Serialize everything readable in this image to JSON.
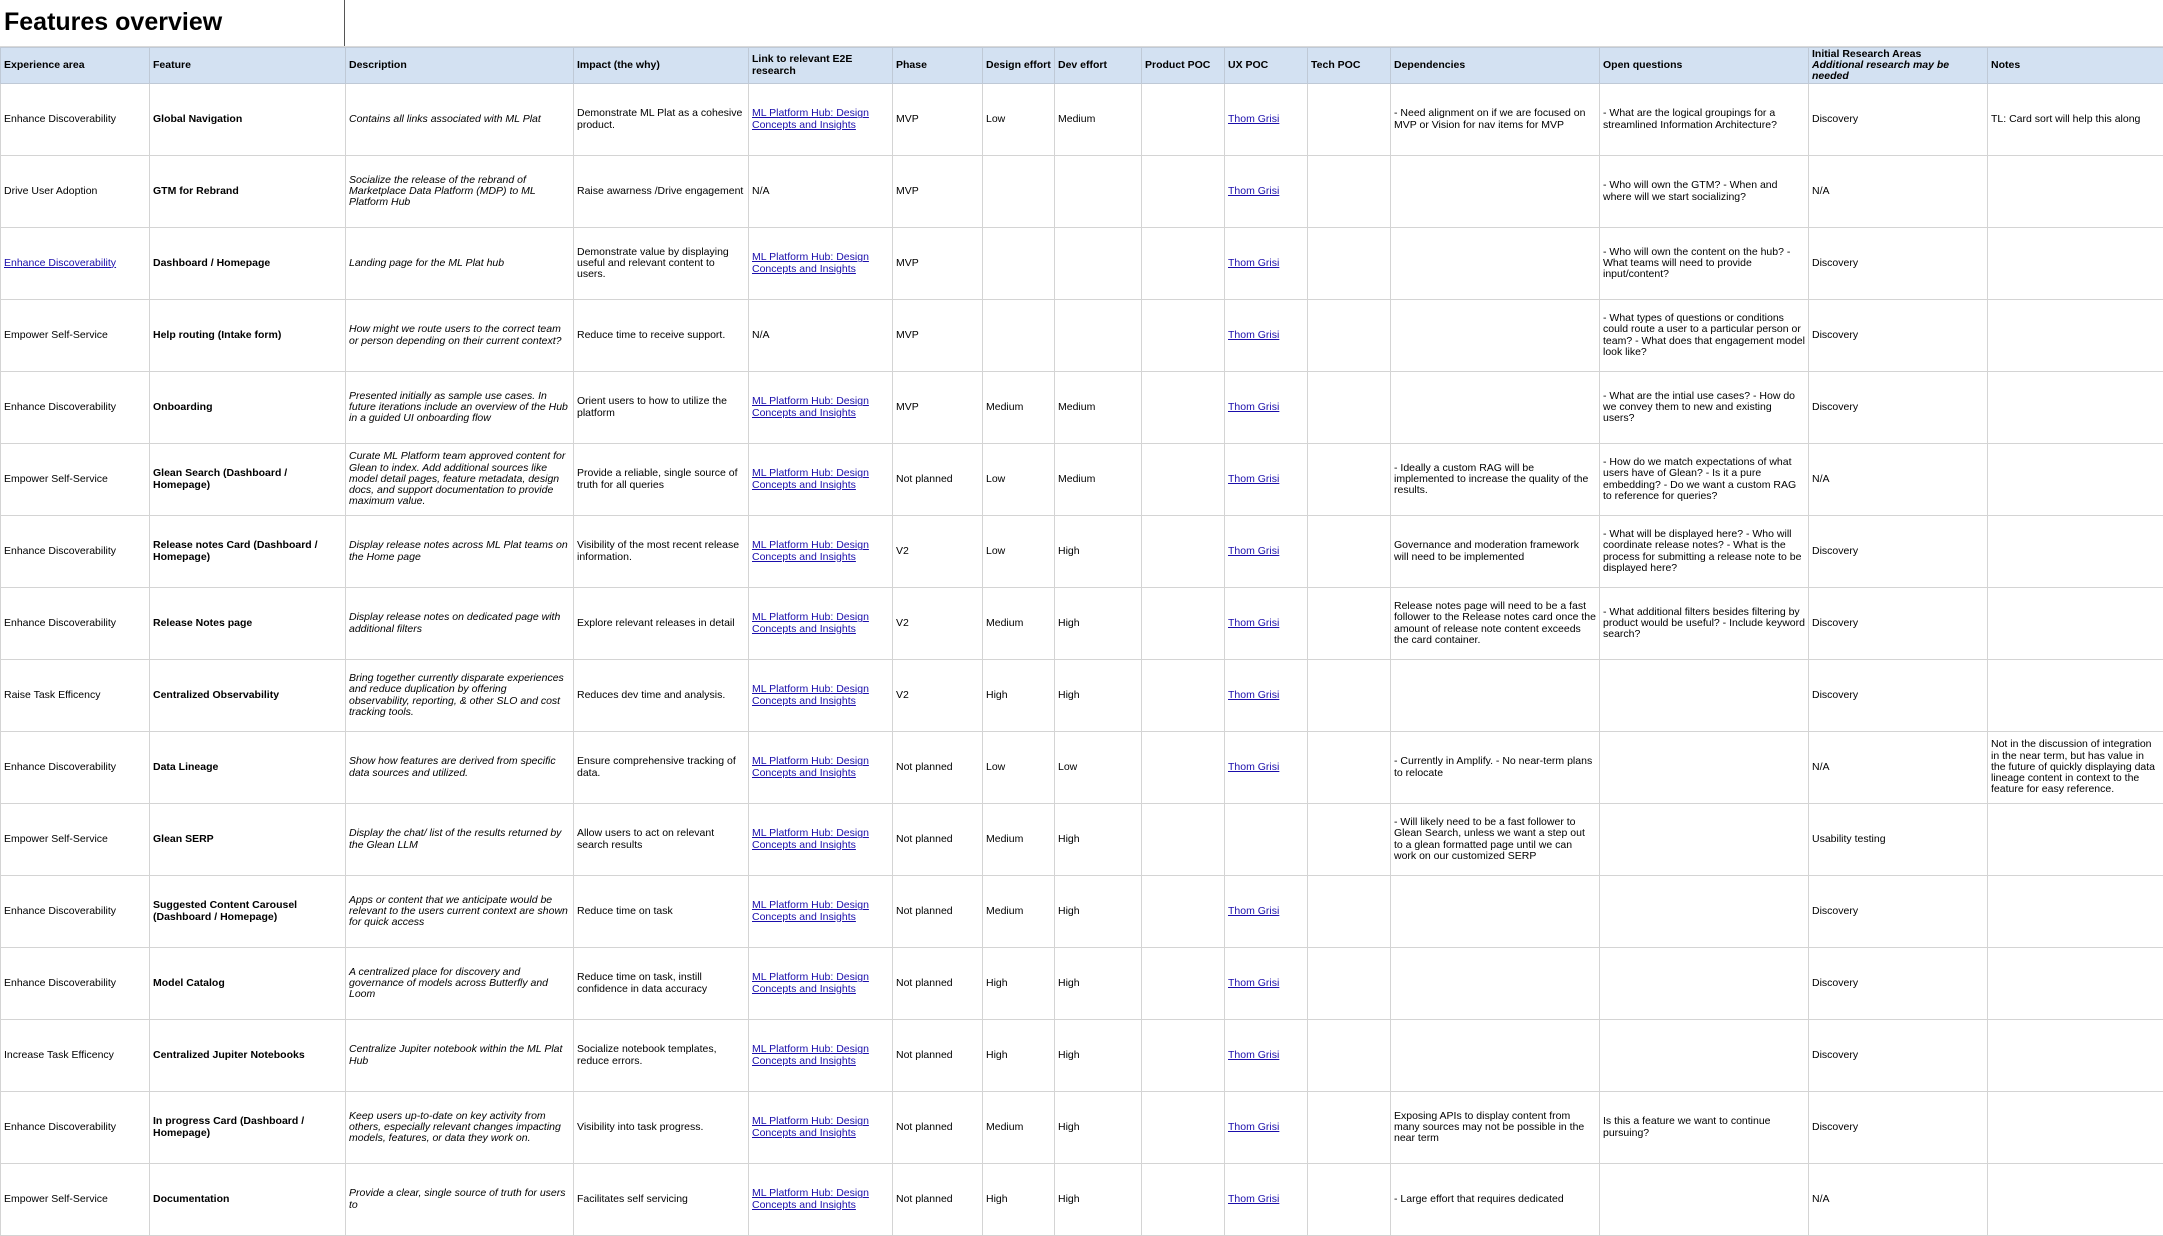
{
  "sheet": {
    "title": "Features overview"
  },
  "columns": [
    "Experience area",
    "Feature",
    "Description",
    "Impact (the why)",
    "Link to relevant E2E research",
    "Phase",
    "Design effort",
    "Dev effort",
    "Product POC",
    "UX POC",
    "Tech POC",
    "Dependencies",
    "Open questions",
    "Initial Research Areas",
    "Notes"
  ],
  "research_subheader": "Additional research may be needed",
  "rows": [
    {
      "area": "Enhance Discoverability",
      "area_link": false,
      "feature": "Global Navigation",
      "desc": "Contains all links associated with ML Plat",
      "impact": "Demonstrate ML Plat as a cohesive product.",
      "link": "ML Platform Hub: Design Concepts and Insights",
      "link_is_link": true,
      "phase": "MVP",
      "design": "Low",
      "dev": "Medium",
      "product": "",
      "ux": "Thom Grisi",
      "tech": "",
      "deps": "- Need alignment on if we are focused on MVP or Vision for nav items for MVP",
      "questions": "- What are the logical groupings for a streamlined Information Architecture?",
      "research": "Discovery",
      "notes": "TL: Card sort will help this along"
    },
    {
      "area": "Drive User Adoption",
      "area_link": false,
      "feature": "GTM for Rebrand",
      "desc": "Socialize the release of the rebrand of Marketplace Data Platform (MDP) to ML Platform Hub",
      "impact": "Raise awarness /Drive engagement",
      "link": "N/A",
      "link_is_link": false,
      "phase": "MVP",
      "design": "",
      "dev": "",
      "product": "",
      "ux": "Thom Grisi",
      "tech": "",
      "deps": "",
      "questions": "- Who will own the GTM?\n- When and where will we start socializing?",
      "research": "N/A",
      "notes": ""
    },
    {
      "area": "Enhance Discoverability",
      "area_link": true,
      "feature": "Dashboard / Homepage",
      "desc": "Landing page for the ML Plat hub",
      "impact": "Demonstrate value by displaying useful and relevant content to users.",
      "link": "ML Platform Hub: Design Concepts and Insights",
      "link_is_link": true,
      "phase": "MVP",
      "design": "",
      "dev": "",
      "product": "",
      "ux": "Thom Grisi",
      "tech": "",
      "deps": "",
      "questions": "- Who will own the content on the hub?\n- What teams will need to provide input/content?",
      "research": "Discovery",
      "notes": ""
    },
    {
      "area": "Empower Self-Service",
      "area_link": false,
      "feature": "Help routing (Intake form)",
      "desc": "How might we route users to the correct team or person depending on their current context?",
      "impact": "Reduce time to receive support.",
      "link": "N/A",
      "link_is_link": false,
      "phase": "MVP",
      "design": "",
      "dev": "",
      "product": "",
      "ux": "Thom Grisi",
      "tech": "",
      "deps": "",
      "questions": "- What types of questions or conditions could route a user to a particular person or team?\n- What does that engagement model look like?",
      "research": "Discovery",
      "notes": ""
    },
    {
      "area": "Enhance Discoverability",
      "area_link": false,
      "feature": "Onboarding",
      "desc": "Presented initially as sample use cases. In future iterations include an overview of the Hub in a guided UI onboarding flow",
      "impact": "Orient users to how to utilize the platform",
      "link": "ML Platform Hub: Design Concepts and Insights",
      "link_is_link": true,
      "phase": "MVP",
      "design": "Medium",
      "dev": "Medium",
      "product": "",
      "ux": "Thom Grisi",
      "tech": "",
      "deps": "",
      "questions": "- What are the intial use cases?\n- How do we convey them to new and existing users?",
      "research": "Discovery",
      "notes": ""
    },
    {
      "area": "Empower Self-Service",
      "area_link": false,
      "feature": "Glean Search (Dashboard / Homepage)",
      "desc": "Curate ML Platform team approved content for Glean to index. Add additional sources like model detail pages, feature metadata, design docs, and support documentation to provide maximum value.",
      "impact": "Provide a reliable, single source of truth for all queries",
      "link": "ML Platform Hub: Design Concepts and Insights",
      "link_is_link": true,
      "phase": "Not planned",
      "design": "Low",
      "dev": "Medium",
      "product": "",
      "ux": "Thom Grisi",
      "tech": "",
      "deps": "- Ideally a custom RAG will be implemented to increase the quality of the results.",
      "questions": "- How do we match expectations of what users have of Glean?\n- Is it a pure embedding?\n- Do we want a custom RAG to reference for queries?",
      "research": "N/A",
      "notes": ""
    },
    {
      "area": "Enhance Discoverability",
      "area_link": false,
      "feature": "Release notes Card (Dashboard / Homepage)",
      "desc": "Display release notes across ML Plat teams on the Home page",
      "impact": "Visibility of the most recent release information.",
      "link": "ML Platform Hub: Design Concepts and Insights",
      "link_is_link": true,
      "phase": "V2",
      "design": "Low",
      "dev": "High",
      "product": "",
      "ux": "Thom Grisi",
      "tech": "",
      "deps": "Governance and moderation framework will need to be implemented",
      "questions": "- What will be displayed here?\n- Who will coordinate release notes?\n- What is the process for submitting a release note to be displayed here?",
      "research": "Discovery",
      "notes": ""
    },
    {
      "area": "Enhance Discoverability",
      "area_link": false,
      "feature": "Release Notes page",
      "desc": "Display release notes on dedicated page with additional filters",
      "impact": "Explore relevant releases in detail",
      "link": "ML Platform Hub: Design Concepts and Insights",
      "link_is_link": true,
      "phase": "V2",
      "design": "Medium",
      "dev": "High",
      "product": "",
      "ux": "Thom Grisi",
      "tech": "",
      "deps": "Release notes page will need to be a fast follower to the Release notes card once the amount of release note content exceeds the card container.",
      "questions": "- What additional filters besides filtering by product would be useful?\n- Include keyword search?",
      "research": "Discovery",
      "notes": ""
    },
    {
      "area": "Raise Task Efficency",
      "area_link": false,
      "feature": "Centralized Observability",
      "desc": "Bring together currently disparate experiences and reduce duplication by offering observability, reporting, & other SLO and cost tracking tools.",
      "impact": "Reduces dev time and analysis.",
      "link": "ML Platform Hub: Design Concepts and Insights",
      "link_is_link": true,
      "phase": "V2",
      "design": "High",
      "dev": "High",
      "product": "",
      "ux": "Thom Grisi",
      "tech": "",
      "deps": "",
      "questions": "",
      "research": "Discovery",
      "notes": ""
    },
    {
      "area": "Enhance Discoverability",
      "area_link": false,
      "feature": "Data Lineage",
      "desc": "Show how features are derived from specific data sources and utilized.",
      "impact": "Ensure comprehensive tracking of data.",
      "link": "ML Platform Hub: Design Concepts and Insights",
      "link_is_link": true,
      "phase": "Not planned",
      "design": "Low",
      "dev": "Low",
      "product": "",
      "ux": "Thom Grisi",
      "tech": "",
      "deps": "- Currently in Amplify.\n- No near-term plans to relocate",
      "questions": "",
      "research": "N/A",
      "notes": "Not in the discussion of integration in the near term, but has value in the future of quickly displaying data lineage content in context to the feature for easy reference."
    },
    {
      "area": "Empower Self-Service",
      "area_link": false,
      "feature": "Glean SERP",
      "desc": "Display the chat/ list of the results returned by the Glean LLM",
      "impact": "Allow users to act on relevant search results",
      "link": "ML Platform Hub: Design Concepts and Insights",
      "link_is_link": true,
      "phase": "Not planned",
      "design": "Medium",
      "dev": "High",
      "product": "",
      "ux": "",
      "tech": "",
      "deps": "- Will likely need to be a fast follower to Glean Search, unless we want a step out to a glean formatted page until we can work on our customized SERP",
      "questions": "",
      "research": "Usability testing",
      "notes": ""
    },
    {
      "area": "Enhance Discoverability",
      "area_link": false,
      "feature": "Suggested Content Carousel (Dashboard / Homepage)",
      "desc": "Apps or content that we anticipate would be relevant to the users current context are shown for quick access",
      "impact": "Reduce time on task",
      "link": "ML Platform Hub: Design Concepts and Insights",
      "link_is_link": true,
      "phase": "Not planned",
      "design": "Medium",
      "dev": "High",
      "product": "",
      "ux": "Thom Grisi",
      "tech": "",
      "deps": "",
      "questions": "",
      "research": "Discovery",
      "notes": ""
    },
    {
      "area": "Enhance Discoverability",
      "area_link": false,
      "feature": "Model Catalog",
      "desc": "A centralized place for discovery and governance of models across Butterfly and Loom",
      "impact": "Reduce time on task, instill confidence in data accuracy",
      "link": "ML Platform Hub: Design Concepts and Insights",
      "link_is_link": true,
      "phase": "Not planned",
      "design": "High",
      "dev": "High",
      "product": "",
      "ux": "Thom Grisi",
      "tech": "",
      "deps": "",
      "questions": "",
      "research": "Discovery",
      "notes": ""
    },
    {
      "area": "Increase Task Efficency",
      "area_link": false,
      "feature": "Centralized Jupiter Notebooks",
      "desc": "Centralize Jupiter notebook within the ML Plat Hub",
      "impact": "Socialize notebook templates, reduce errors.",
      "link": "ML Platform Hub: Design Concepts and Insights",
      "link_is_link": true,
      "phase": "Not planned",
      "design": "High",
      "dev": "High",
      "product": "",
      "ux": "Thom Grisi",
      "tech": "",
      "deps": "",
      "questions": "",
      "research": "Discovery",
      "notes": ""
    },
    {
      "area": "Enhance Discoverability",
      "area_link": false,
      "feature": "In progress Card (Dashboard / Homepage)",
      "desc": "Keep users up-to-date on key activity from others, especially relevant changes impacting models, features, or data they work on.",
      "impact": "Visibility into task progress.",
      "link": "ML Platform Hub: Design Concepts and Insights",
      "link_is_link": true,
      "phase": "Not planned",
      "design": "Medium",
      "dev": "High",
      "product": "",
      "ux": "Thom Grisi",
      "tech": "",
      "deps": "Exposing APIs to display content from many sources may not be possible in the near term",
      "questions": "Is this a feature we want to continue pursuing?",
      "research": "Discovery",
      "notes": ""
    },
    {
      "area": "Empower Self-Service",
      "area_link": false,
      "feature": "Documentation",
      "desc": "Provide a clear, single source of truth for users to",
      "impact": "Facilitates self servicing",
      "link": "ML Platform Hub: Design Concepts and Insights",
      "link_is_link": true,
      "phase": "Not planned",
      "design": "High",
      "dev": "High",
      "product": "",
      "ux": "Thom Grisi",
      "tech": "",
      "deps": "- Large effort that requires dedicated",
      "questions": "",
      "research": "N/A",
      "notes": ""
    }
  ]
}
